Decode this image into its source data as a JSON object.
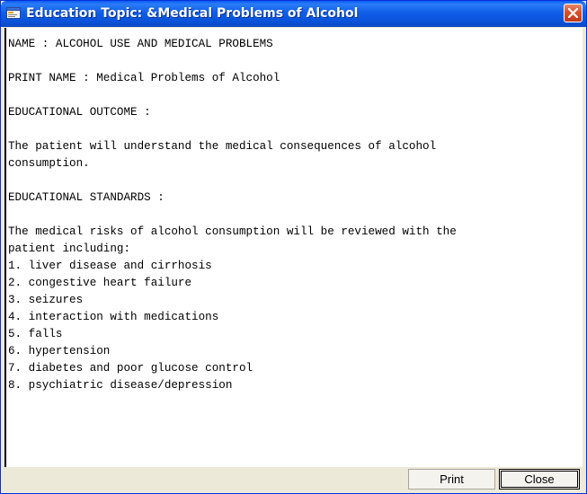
{
  "window": {
    "title": "Education Topic: &Medical Problems of Alcohol"
  },
  "content": {
    "lines": [
      "NAME : ALCOHOL USE AND MEDICAL PROBLEMS",
      "",
      "PRINT NAME : Medical Problems of Alcohol",
      "",
      "EDUCATIONAL OUTCOME :",
      "",
      "The patient will understand the medical consequences of alcohol",
      "consumption.",
      "",
      "EDUCATIONAL STANDARDS :",
      "",
      "The medical risks of alcohol consumption will be reviewed with the",
      "patient including:",
      "1. liver disease and cirrhosis",
      "2. congestive heart failure",
      "3. seizures",
      "4. interaction with medications",
      "5. falls",
      "6. hypertension",
      "7. diabetes and poor glucose control",
      "8. psychiatric disease/depression"
    ]
  },
  "buttons": {
    "print_label": "Print",
    "close_label": "Close"
  },
  "icons": {
    "app": "education-window-icon",
    "close": "close-icon"
  },
  "colors": {
    "titlebar": "#0a53d9",
    "close_button": "#d8502a"
  }
}
